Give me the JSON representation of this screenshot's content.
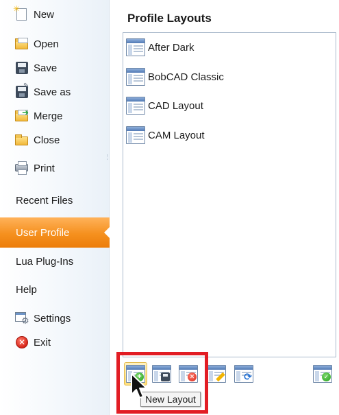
{
  "sidebar": {
    "items": [
      {
        "label": "New",
        "icon": "new-document-icon"
      },
      {
        "label": "Open",
        "icon": "open-folder-icon"
      },
      {
        "label": "Save",
        "icon": "save-disk-icon"
      },
      {
        "label": "Save as",
        "icon": "save-as-disk-icon"
      },
      {
        "label": "Merge",
        "icon": "merge-folder-icon"
      },
      {
        "label": "Close",
        "icon": "close-folder-icon"
      },
      {
        "label": "Print",
        "icon": "printer-icon"
      },
      {
        "label": "Recent Files",
        "icon": ""
      },
      {
        "label": "User Profile",
        "icon": "",
        "active": true
      },
      {
        "label": "Lua Plug-Ins",
        "icon": ""
      },
      {
        "label": "Help",
        "icon": ""
      },
      {
        "label": "Settings",
        "icon": "settings-gear-icon"
      },
      {
        "label": "Exit",
        "icon": "exit-icon"
      }
    ]
  },
  "main": {
    "title": "Profile Layouts",
    "layouts": [
      {
        "label": "After Dark"
      },
      {
        "label": "BobCAD Classic"
      },
      {
        "label": "CAD Layout"
      },
      {
        "label": "CAM Layout"
      }
    ],
    "toolbar": {
      "buttons": [
        {
          "name": "new-layout",
          "icon": "new-layout-icon"
        },
        {
          "name": "save-layout",
          "icon": "save-layout-icon"
        },
        {
          "name": "delete-layout",
          "icon": "delete-layout-icon"
        },
        {
          "name": "rename-layout",
          "icon": "rename-layout-icon"
        },
        {
          "name": "refresh-layout",
          "icon": "refresh-layout-icon"
        },
        {
          "name": "apply-layout",
          "icon": "apply-layout-icon"
        }
      ],
      "tooltip": "New Layout"
    }
  },
  "colors": {
    "active_item": "#f5901e",
    "highlight_box": "#e21d24",
    "list_border": "#a9b8cb"
  }
}
